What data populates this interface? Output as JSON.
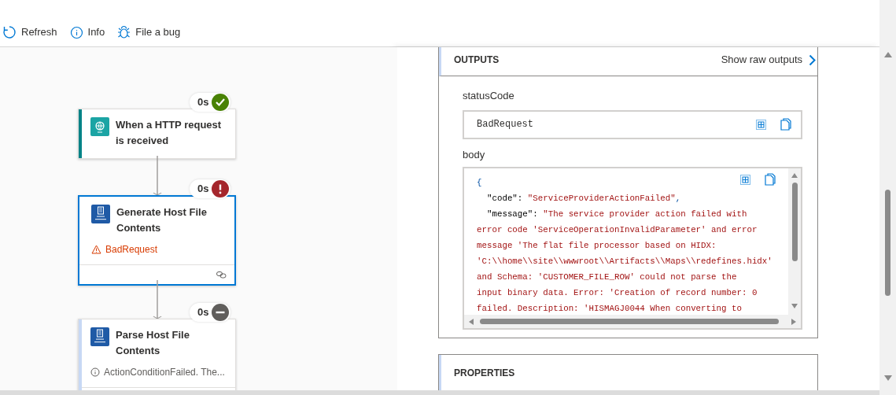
{
  "toolbar": [
    {
      "kind": "refresh",
      "label": "Refresh"
    },
    {
      "kind": "info",
      "label": "Info"
    },
    {
      "kind": "bug",
      "label": "File a bug"
    }
  ],
  "nodes": [
    {
      "title": "When a HTTP request is received",
      "duration": "0s",
      "kind": "succeeded",
      "selected": false
    },
    {
      "title": "Generate Host File Contents",
      "duration": "0s",
      "kind": "failed",
      "selected": true,
      "message": "BadRequest"
    },
    {
      "title": "Parse Host File Contents",
      "duration": "0s",
      "kind": "skipped",
      "selected": false,
      "message": "ActionConditionFailed. The..."
    }
  ],
  "outputs": {
    "title": "OUTPUTS",
    "raw_link": "Show raw outputs",
    "fields": [
      {
        "label": "statusCode",
        "value": "BadRequest"
      }
    ],
    "body": {
      "label": "body",
      "lines": [
        [
          {
            "kind": "punct",
            "text": "{"
          }
        ],
        [
          {
            "kind": "key",
            "text": "  \"code\": "
          },
          {
            "kind": "string",
            "text": "\"ServiceProviderActionFailed\""
          },
          {
            "kind": "punct",
            "text": ","
          }
        ],
        [
          {
            "kind": "key",
            "text": "  \"message\": "
          },
          {
            "kind": "string",
            "text": "\"The service provider action failed with"
          }
        ],
        [
          {
            "kind": "string",
            "text": "error code 'ServiceOperationInvalidParameter' and error"
          }
        ],
        [
          {
            "kind": "string",
            "text": "message 'The flat file processor based on HIDX:"
          }
        ],
        [
          {
            "kind": "string",
            "text": "'C:\\\\home\\\\site\\\\wwwroot\\\\Artifacts\\\\Maps\\\\redefines.hidx'"
          }
        ],
        [
          {
            "kind": "string",
            "text": "and Schema: 'CUSTOMER_FILE_ROW' could not parse the"
          }
        ],
        [
          {
            "kind": "string",
            "text": "input binary data. Error: 'Creation of record number: 0"
          }
        ],
        [
          {
            "kind": "string",
            "text": "failed. Description: 'HISMAGJ0044 When converting to"
          }
        ]
      ]
    }
  },
  "properties": {
    "title": "PROPERTIES"
  }
}
